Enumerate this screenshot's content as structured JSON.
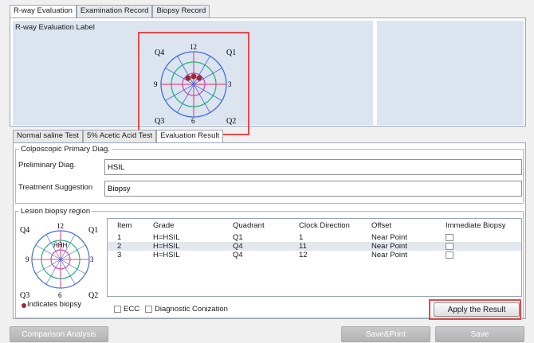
{
  "tabs": [
    "R-way Evaluation",
    "Examination Record",
    "Biopsy Record"
  ],
  "label_panel": {
    "title": "R-way Evaluation Label"
  },
  "clock_large": {
    "q4": "Q4",
    "q1": "Q1",
    "q3": "Q3",
    "q2": "Q2",
    "n12": "12",
    "n3": "3",
    "n6": "6",
    "n9": "9"
  },
  "subtabs": [
    "Normal saline Test",
    "5% Acetic Acid Test",
    "Evaluation Result"
  ],
  "primary_diag": {
    "legend": "Colposcopic Primary Diag.",
    "preliminary_label": "Preliminary Diag.",
    "preliminary_value": "HSIL",
    "treatment_label": "Treatment Suggestion",
    "treatment_value": "Biopsy"
  },
  "biopsy_region": {
    "legend": "Lesion biopsy region",
    "clock": {
      "q4": "Q4",
      "q1": "Q1",
      "q3": "Q3",
      "q2": "Q2",
      "n12": "12",
      "n3": "3",
      "n6": "6",
      "n9": "9",
      "marker": "ĤĤH"
    },
    "indicates": "Indicates biopsy",
    "headers": [
      "Item",
      "Grade",
      "Quadrant",
      "Clock Direction",
      "Offset",
      "Immediate Biopsy"
    ],
    "rows": [
      [
        "1",
        "H=HSIL",
        "Q1",
        "1",
        "Near Point"
      ],
      [
        "2",
        "H=HSIL",
        "Q4",
        "11",
        "Near Point"
      ],
      [
        "3",
        "H=HSIL",
        "Q4",
        "12",
        "Near Point"
      ]
    ],
    "ecc": "ECC",
    "conization": "Diagnostic Conization"
  },
  "buttons": {
    "apply": "Apply the Result",
    "comparison": "Comparison Analysis",
    "save_print": "Save&Print",
    "save": "Save"
  },
  "colors": {
    "highlight": "#e24a4a",
    "biopsy_dot": "#9b2a3a",
    "clock_outer": "#3f6fd8",
    "clock_mid": "#2bb37a",
    "clock_inner": "#d04bb0",
    "axis": "#e04a8a"
  }
}
